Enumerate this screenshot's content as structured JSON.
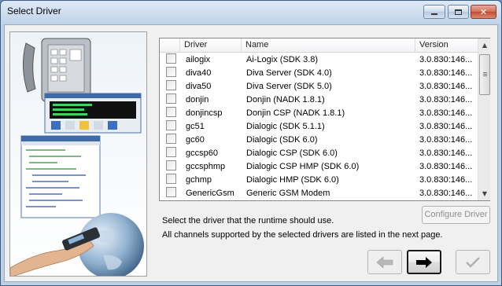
{
  "window": {
    "title": "Select Driver",
    "controls": {
      "minimize": "minimize",
      "maximize": "maximize",
      "close": "close"
    }
  },
  "drivers": {
    "columns": {
      "check": "",
      "driver": "Driver",
      "name": "Name",
      "version": "Version"
    },
    "rows": [
      {
        "checked": false,
        "driver": "ailogix",
        "name": "Ai-Logix (SDK 3.8)",
        "version": "3.0.830:146..."
      },
      {
        "checked": false,
        "driver": "diva40",
        "name": "Diva Server (SDK 4.0)",
        "version": "3.0.830:146..."
      },
      {
        "checked": false,
        "driver": "diva50",
        "name": "Diva Server (SDK 5.0)",
        "version": "3.0.830:146..."
      },
      {
        "checked": false,
        "driver": "donjin",
        "name": "Donjin (NADK 1.8.1)",
        "version": "3.0.830:146..."
      },
      {
        "checked": false,
        "driver": "donjincsp",
        "name": "Donjin CSP (NADK 1.8.1)",
        "version": "3.0.830:146..."
      },
      {
        "checked": false,
        "driver": "gc51",
        "name": "Dialogic (SDK 5.1.1)",
        "version": "3.0.830:146..."
      },
      {
        "checked": false,
        "driver": "gc60",
        "name": "Dialogic (SDK 6.0)",
        "version": "3.0.830:146..."
      },
      {
        "checked": false,
        "driver": "gccsp60",
        "name": "Dialogic CSP (SDK 6.0)",
        "version": "3.0.830:146..."
      },
      {
        "checked": false,
        "driver": "gccsphmp",
        "name": "Dialogic CSP HMP (SDK 6.0)",
        "version": "3.0.830:146..."
      },
      {
        "checked": false,
        "driver": "gchmp",
        "name": "Dialogic HMP (SDK 6.0)",
        "version": "3.0.830:146..."
      },
      {
        "checked": false,
        "driver": "GenericGsm",
        "name": "Generic GSM Modem",
        "version": "3.0.830:146..."
      }
    ]
  },
  "configure_button": {
    "label": "Configure Driver",
    "enabled": false
  },
  "info": {
    "line1": "Select the driver that the runtime should use.",
    "line2": "All channels supported by the selected drivers are listed in the next page."
  },
  "nav": {
    "back": {
      "icon": "arrow-left-icon",
      "enabled": false
    },
    "next": {
      "icon": "arrow-right-icon",
      "enabled": true
    },
    "finish": {
      "icon": "checkmark-icon",
      "enabled": false
    }
  },
  "colors": {
    "title_gradient_top": "#dfe9f5",
    "client_bg": "#f0f0f0",
    "close_red": "#c24a31"
  }
}
